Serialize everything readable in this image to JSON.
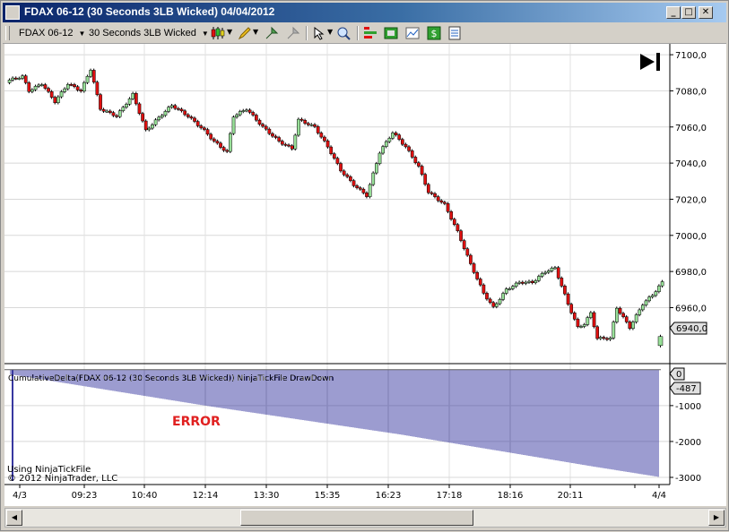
{
  "window": {
    "title": "FDAX 06-12 (30 Seconds 3LB Wicked)  04/04/2012"
  },
  "toolbar": {
    "instrument": "FDAX 06-12",
    "period": "30 Seconds 3LB Wicked"
  },
  "price_panel": {
    "last_price": "6940,0"
  },
  "indicator_panel": {
    "label": "CumulativeDelta(FDAX 06-12 (30 Seconds 3LB Wicked)) NinjaTickFile DrawDown",
    "current_value": "-487",
    "zero_label": "0",
    "error_text": "ERROR"
  },
  "footer": {
    "source": "Using NinjaTickFile",
    "copyright": "© 2012 NinjaTrader, LLC"
  },
  "icons": [
    "candlestick-icon",
    "draw-tool-icon",
    "zoom-icon",
    "pointer-icon",
    "magnifier-icon",
    "indicator-icon",
    "strategy-icon",
    "chart-properties-icon",
    "dollar-icon",
    "data-box-icon",
    "go-to-end-icon"
  ],
  "chart_data": [
    {
      "type": "candlestick",
      "title": "FDAX 06-12 (30 Seconds 3LB Wicked)",
      "ylim": [
        6930,
        7105
      ],
      "y_ticks": [
        "7100,0",
        "7080,0",
        "7060,0",
        "7040,0",
        "7020,0",
        "7000,0",
        "6980,0",
        "6960,0"
      ],
      "x_ticks": [
        "4/3",
        "09:23",
        "10:40",
        "12:14",
        "13:30",
        "15:35",
        "16:23",
        "17:18",
        "18:16",
        "20:11",
        "4/4"
      ],
      "bull_color": "#98e098",
      "bear_color": "#e01010",
      "close_path": [
        [
          0,
          7086
        ],
        [
          4,
          7088
        ],
        [
          6,
          7080
        ],
        [
          10,
          7084
        ],
        [
          14,
          7074
        ],
        [
          18,
          7084
        ],
        [
          22,
          7080
        ],
        [
          25,
          7092
        ],
        [
          28,
          7070
        ],
        [
          33,
          7066
        ],
        [
          38,
          7078
        ],
        [
          42,
          7058
        ],
        [
          47,
          7067
        ],
        [
          50,
          7072
        ],
        [
          55,
          7066
        ],
        [
          60,
          7058
        ],
        [
          63,
          7052
        ],
        [
          67,
          7046
        ],
        [
          69,
          7066
        ],
        [
          73,
          7070
        ],
        [
          78,
          7060
        ],
        [
          83,
          7052
        ],
        [
          87,
          7048
        ],
        [
          89,
          7064
        ],
        [
          94,
          7060
        ],
        [
          98,
          7049
        ],
        [
          102,
          7036
        ],
        [
          106,
          7028
        ],
        [
          110,
          7022
        ],
        [
          114,
          7046
        ],
        [
          118,
          7057
        ],
        [
          122,
          7049
        ],
        [
          126,
          7038
        ],
        [
          129,
          7024
        ],
        [
          134,
          7017
        ],
        [
          138,
          7002
        ],
        [
          142,
          6984
        ],
        [
          146,
          6968
        ],
        [
          149,
          6960
        ],
        [
          153,
          6970
        ],
        [
          157,
          6974
        ],
        [
          161,
          6974
        ],
        [
          165,
          6980
        ],
        [
          168,
          6982
        ],
        [
          172,
          6962
        ],
        [
          175,
          6949
        ],
        [
          177,
          6951
        ],
        [
          179,
          6957
        ],
        [
          181,
          6943
        ],
        [
          185,
          6943
        ],
        [
          187,
          6960
        ],
        [
          191,
          6949
        ],
        [
          195,
          6962
        ],
        [
          198,
          6967
        ],
        [
          201,
          6974
        ]
      ],
      "last_close": 6940
    },
    {
      "type": "bar",
      "title": "CumulativeDelta(FDAX 06-12 (30 Seconds 3LB Wicked)) NinjaTickFile DrawDown",
      "ylim": [
        -3150,
        120
      ],
      "y_ticks": [
        "-1000",
        "-2000",
        "-3000"
      ],
      "color": "#3838a0",
      "path": [
        [
          0,
          -130
        ],
        [
          60,
          -1000
        ],
        [
          120,
          -1800
        ],
        [
          180,
          -2700
        ],
        [
          201,
          -3000
        ]
      ],
      "last_value": -487
    }
  ]
}
